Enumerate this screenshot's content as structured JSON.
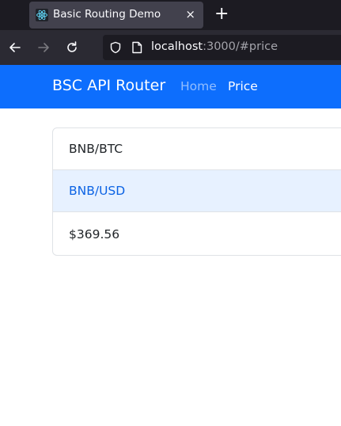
{
  "browser": {
    "tab_title": "Basic Routing Demo",
    "tab_close": "×",
    "new_tab": "+",
    "url_host": "localhost",
    "url_rest": ":3000/#price"
  },
  "navbar": {
    "brand": "BSC API Router",
    "links": [
      {
        "label": "Home",
        "active": false
      },
      {
        "label": "Price",
        "active": true
      }
    ]
  },
  "list": {
    "items": [
      {
        "text": "BNB/BTC"
      },
      {
        "text": "BNB/USD"
      },
      {
        "text": "$369.56"
      }
    ]
  },
  "colors": {
    "navbar": "#0d6efd",
    "highlight_bg": "#e7f1ff",
    "highlight_text": "#0c63e4"
  },
  "icons": {
    "tab_favicon": "react-logo-icon",
    "back": "arrow-left-icon",
    "forward": "arrow-right-icon",
    "reload": "reload-icon",
    "security": "shield-icon",
    "page": "page-icon"
  }
}
